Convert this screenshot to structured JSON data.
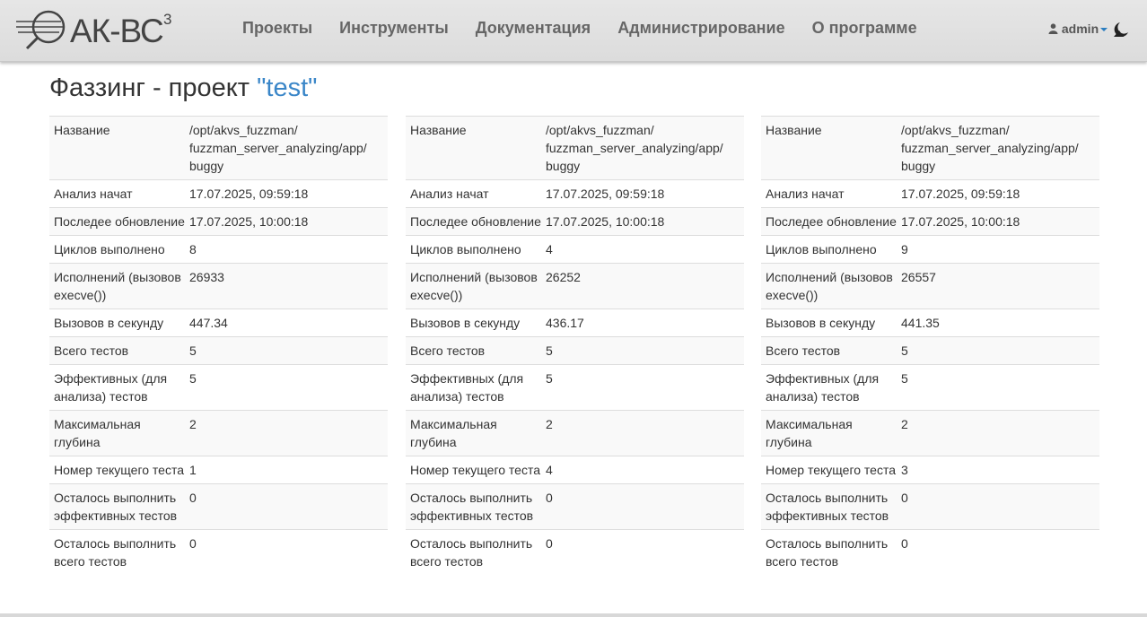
{
  "brand": {
    "name": "АК-ВС",
    "version": "3"
  },
  "nav": {
    "items": [
      "Проекты",
      "Инструменты",
      "Документация",
      "Администрирование",
      "О программе"
    ]
  },
  "user": {
    "name": "admin"
  },
  "page": {
    "title_prefix": "Фаззинг - проект ",
    "project_name": "\"test\""
  },
  "labels": [
    "Название",
    "Анализ начат",
    "Последее обновление",
    "Циклов выполнено",
    "Исполнений (вызовов execve())",
    "Вызовов в секунду",
    "Всего тестов",
    "Эффективных (для анализа) тестов",
    "Максимальная глубина",
    "Номер текущего теста",
    "Осталось выполнить эффективных тестов",
    "Осталось выполнить всего тестов"
  ],
  "panels": [
    {
      "values": [
        "/opt/akvs_fuzzman/ fuzzman_server_analyzing/app/ buggy",
        "17.07.2025, 09:59:18",
        "17.07.2025, 10:00:18",
        "8",
        "26933",
        "447.34",
        "5",
        "5",
        "2",
        "1",
        "0",
        "0"
      ]
    },
    {
      "values": [
        "/opt/akvs_fuzzman/ fuzzman_server_analyzing/app/ buggy",
        "17.07.2025, 09:59:18",
        "17.07.2025, 10:00:18",
        "4",
        "26252",
        "436.17",
        "5",
        "5",
        "2",
        "4",
        "0",
        "0"
      ]
    },
    {
      "values": [
        "/opt/akvs_fuzzman/ fuzzman_server_analyzing/app/ buggy",
        "17.07.2025, 09:59:18",
        "17.07.2025, 10:00:18",
        "9",
        "26557",
        "441.35",
        "5",
        "5",
        "2",
        "3",
        "0",
        "0"
      ]
    }
  ],
  "icons": {
    "user": "user-icon",
    "theme": "moon-icon",
    "logo": "magnifier-logo-icon"
  }
}
